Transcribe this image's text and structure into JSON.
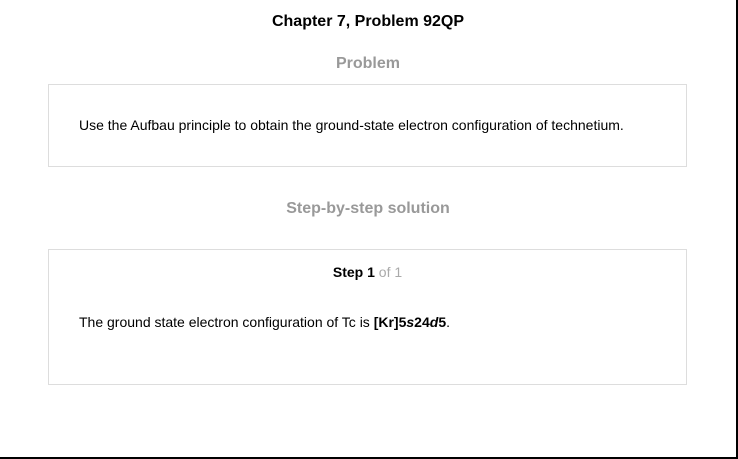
{
  "header": {
    "title": "Chapter 7, Problem 92QP"
  },
  "problem": {
    "heading": "Problem",
    "text": "Use the Aufbau principle to obtain the ground-state electron configuration of technetium."
  },
  "solution": {
    "heading": "Step-by-step solution",
    "step": {
      "word": "Step",
      "number": "1",
      "of_text": "of 1"
    },
    "answer_prefix": "The ground state electron configuration of Tc is ",
    "config_core": "[Kr]5",
    "config_s": "s",
    "config_mid": "24",
    "config_d": "d",
    "config_end": "5",
    "answer_suffix": "."
  }
}
